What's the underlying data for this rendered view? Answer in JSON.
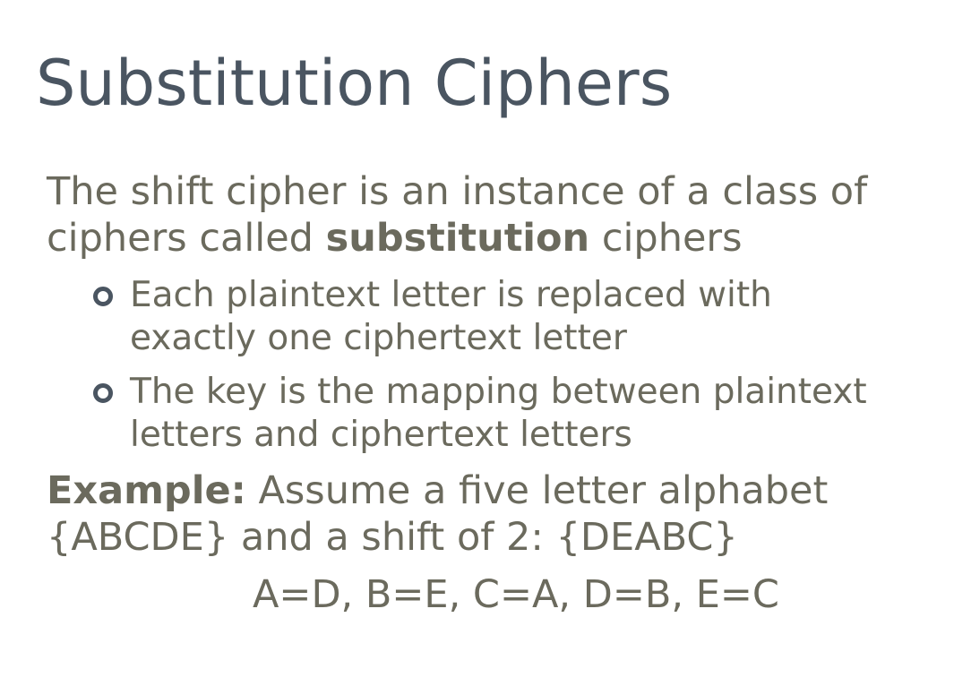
{
  "slide": {
    "title": "Substitution Ciphers",
    "intro": {
      "line1": "The shift cipher is an instance of a class of",
      "line2_before": "ciphers called ",
      "line2_bold": "substitution",
      "line2_after": " ciphers"
    },
    "bullets": [
      {
        "line1": "Each plaintext letter is replaced with",
        "line2": "exactly one ciphertext letter",
        "icon": "hollow-circle-bullet"
      },
      {
        "line1": "The key is the mapping between plaintext",
        "line2": "letters and ciphertext letters",
        "icon": "hollow-circle-bullet"
      }
    ],
    "example": {
      "label": "Example:",
      "line1_rest": " Assume a five letter alphabet",
      "line2": "{ABCDE} and a shift of 2: {DEABC}"
    },
    "mapping": "A=D, B=E, C=A, D=B, E=C"
  },
  "colors": {
    "title": "#4a5561",
    "body_text": "#6b6a5d",
    "background": "#ffffff"
  }
}
